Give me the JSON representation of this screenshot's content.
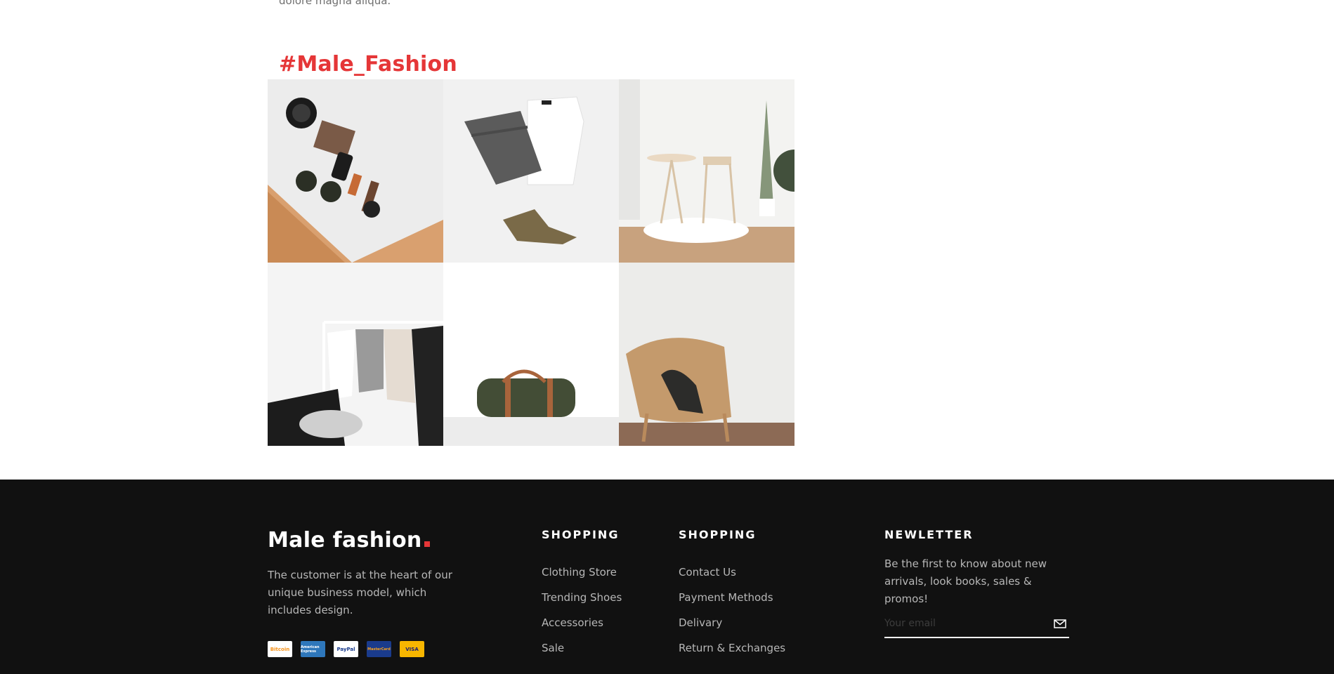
{
  "intro": {
    "trailing_text": "dolore magna aliqua."
  },
  "instagram": {
    "hashtag": "#Male_Fashion",
    "images": [
      "image-accessories-flatlay",
      "image-jeans-tshirt-boots",
      "image-interior-chair-table",
      "image-clothing-rack",
      "image-duffel-bag",
      "image-wicker-chair"
    ]
  },
  "footer": {
    "logo_text": "Male fashion",
    "about": "The customer is at the heart of our unique business model, which includes design.",
    "payments": [
      "Bitcoin",
      "American Express",
      "PayPal",
      "MasterCard",
      "VISA"
    ],
    "columns": [
      {
        "title": "SHOPPING",
        "links": [
          "Clothing Store",
          "Trending Shoes",
          "Accessories",
          "Sale"
        ]
      },
      {
        "title": "SHOPPING",
        "links": [
          "Contact Us",
          "Payment Methods",
          "Delivary",
          "Return & Exchanges"
        ]
      }
    ],
    "newsletter": {
      "title": "NEWLETTER",
      "text": "Be the first to know about new arrivals, look books, sales & promos!",
      "placeholder": "Your email",
      "submit_icon": "mail-icon"
    }
  },
  "colors": {
    "accent": "#e53637",
    "footer_bg": "#111111",
    "footer_text": "#b7b7b7"
  }
}
